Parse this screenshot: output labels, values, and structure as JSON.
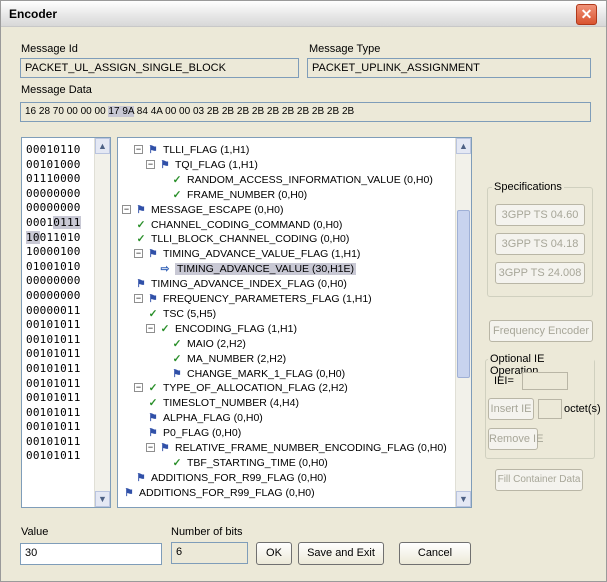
{
  "window": {
    "title": "Encoder",
    "close_glyph": "✕"
  },
  "message_id": {
    "label": "Message Id",
    "value": "PACKET_UL_ASSIGN_SINGLE_BLOCK"
  },
  "message_type": {
    "label": "Message Type",
    "value": "PACKET_UPLINK_ASSIGNMENT"
  },
  "message_data": {
    "label": "Message Data",
    "before": "16 28 70 00 00 00 ",
    "highlight": "17 9A",
    "after": " 84 4A 00 00 03 2B 2B 2B 2B 2B 2B 2B 2B 2B 2B"
  },
  "binary_lines": [
    {
      "pre": "00010110",
      "hl": "",
      "post": ""
    },
    {
      "pre": "00101000",
      "hl": "",
      "post": ""
    },
    {
      "pre": "01110000",
      "hl": "",
      "post": ""
    },
    {
      "pre": "00000000",
      "hl": "",
      "post": ""
    },
    {
      "pre": "00000000",
      "hl": "",
      "post": ""
    },
    {
      "pre": "0001",
      "hl": "0111",
      "post": ""
    },
    {
      "pre": "",
      "hl": "10",
      "post": "011010"
    },
    {
      "pre": "10000100",
      "hl": "",
      "post": ""
    },
    {
      "pre": "01001010",
      "hl": "",
      "post": ""
    },
    {
      "pre": "00000000",
      "hl": "",
      "post": ""
    },
    {
      "pre": "00000000",
      "hl": "",
      "post": ""
    },
    {
      "pre": "00000011",
      "hl": "",
      "post": ""
    },
    {
      "pre": "00101011",
      "hl": "",
      "post": ""
    },
    {
      "pre": "00101011",
      "hl": "",
      "post": ""
    },
    {
      "pre": "00101011",
      "hl": "",
      "post": ""
    },
    {
      "pre": "00101011",
      "hl": "",
      "post": ""
    },
    {
      "pre": "00101011",
      "hl": "",
      "post": ""
    },
    {
      "pre": "00101011",
      "hl": "",
      "post": ""
    },
    {
      "pre": "00101011",
      "hl": "",
      "post": ""
    },
    {
      "pre": "00101011",
      "hl": "",
      "post": ""
    },
    {
      "pre": "00101011",
      "hl": "",
      "post": ""
    },
    {
      "pre": "00101011",
      "hl": "",
      "post": ""
    }
  ],
  "tree": [
    {
      "level": 1,
      "expander": "⊟",
      "icon": "flag",
      "text": "TLLI_FLAG (1,H1)",
      "selected": false
    },
    {
      "level": 2,
      "expander": "⊟",
      "icon": "flag",
      "text": "TQI_FLAG (1,H1)",
      "selected": false
    },
    {
      "level": 4,
      "expander": "",
      "icon": "check",
      "text": "RANDOM_ACCESS_INFORMATION_VALUE (0,H0)",
      "selected": false
    },
    {
      "level": 4,
      "expander": "",
      "icon": "check",
      "text": "FRAME_NUMBER (0,H0)",
      "selected": false
    },
    {
      "level": 0,
      "expander": "⊟",
      "icon": "flag",
      "text": "MESSAGE_ESCAPE (0,H0)",
      "selected": false
    },
    {
      "level": 1,
      "expander": "",
      "icon": "check",
      "text": "CHANNEL_CODING_COMMAND (0,H0)",
      "selected": false
    },
    {
      "level": 1,
      "expander": "",
      "icon": "check",
      "text": "TLLI_BLOCK_CHANNEL_CODING (0,H0)",
      "selected": false
    },
    {
      "level": 1,
      "expander": "⊟",
      "icon": "flag",
      "text": "TIMING_ADVANCE_VALUE_FLAG (1,H1)",
      "selected": false
    },
    {
      "level": 3,
      "expander": "",
      "icon": "arrow",
      "text": "TIMING_ADVANCE_VALUE (30,H1E)",
      "selected": true
    },
    {
      "level": 1,
      "expander": "",
      "icon": "flag",
      "text": "TIMING_ADVANCE_INDEX_FLAG (0,H0)",
      "selected": false
    },
    {
      "level": 1,
      "expander": "⊟",
      "icon": "flag",
      "text": "FREQUENCY_PARAMETERS_FLAG (1,H1)",
      "selected": false
    },
    {
      "level": 2,
      "expander": "",
      "icon": "check",
      "text": "TSC (5,H5)",
      "selected": false
    },
    {
      "level": 2,
      "expander": "⊟",
      "icon": "check",
      "text": "ENCODING_FLAG (1,H1)",
      "selected": false
    },
    {
      "level": 4,
      "expander": "",
      "icon": "check",
      "text": "MAIO (2,H2)",
      "selected": false
    },
    {
      "level": 4,
      "expander": "",
      "icon": "check",
      "text": "MA_NUMBER (2,H2)",
      "selected": false
    },
    {
      "level": 4,
      "expander": "",
      "icon": "flag",
      "text": "CHANGE_MARK_1_FLAG (0,H0)",
      "selected": false
    },
    {
      "level": 1,
      "expander": "⊟",
      "icon": "check",
      "text": "TYPE_OF_ALLOCATION_FLAG (2,H2)",
      "selected": false
    },
    {
      "level": 2,
      "expander": "",
      "icon": "check",
      "text": "TIMESLOT_NUMBER (4,H4)",
      "selected": false
    },
    {
      "level": 2,
      "expander": "",
      "icon": "flag",
      "text": "ALPHA_FLAG (0,H0)",
      "selected": false
    },
    {
      "level": 2,
      "expander": "",
      "icon": "flag",
      "text": "P0_FLAG (0,H0)",
      "selected": false
    },
    {
      "level": 2,
      "expander": "⊟",
      "icon": "flag",
      "text": "RELATIVE_FRAME_NUMBER_ENCODING_FLAG (0,H0)",
      "selected": false
    },
    {
      "level": 4,
      "expander": "",
      "icon": "check",
      "text": "TBF_STARTING_TIME (0,H0)",
      "selected": false
    },
    {
      "level": 1,
      "expander": "",
      "icon": "flag",
      "text": "ADDITIONS_FOR_R99_FLAG (0,H0)",
      "selected": false
    },
    {
      "level": 0,
      "expander": "",
      "icon": "flag",
      "text": "ADDITIONS_FOR_R99_FLAG (0,H0)",
      "selected": false
    }
  ],
  "specifications": {
    "title": "Specifications",
    "buttons": [
      "3GPP TS 04.60",
      "3GPP TS 04.18",
      "3GPP TS 24.008"
    ]
  },
  "frequency_encoder": "Frequency Encoder",
  "optional_ie": {
    "title": "Optional IE Operation",
    "iei_label": "IEI=",
    "insert_label": "Insert IE",
    "octets_label": "octet(s)",
    "remove_label": "Remove IE"
  },
  "fill_container": "Fill Container Data",
  "value": {
    "label": "Value",
    "value": "30"
  },
  "number_of_bits": {
    "label": "Number of bits",
    "value": "6"
  },
  "buttons": {
    "ok": "OK",
    "save_exit": "Save and Exit",
    "cancel": "Cancel"
  },
  "scroll": {
    "up": "▲",
    "down": "▼"
  }
}
